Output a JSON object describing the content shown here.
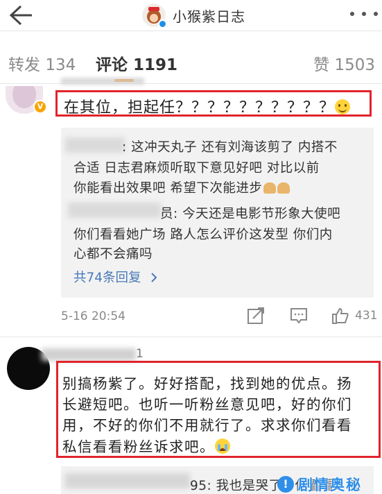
{
  "header": {
    "title": "小猴紫日志",
    "back_icon": "back-arrow-icon",
    "more_icon": "more-dots-icon"
  },
  "tabs": [
    {
      "label": "转发",
      "count": "134"
    },
    {
      "label": "评论",
      "count": "1191"
    },
    {
      "label": "赞",
      "count": "1503"
    }
  ],
  "comment1": {
    "text": "在其位，担起任？？？？？？？？？？",
    "emoji": "smile-emoji",
    "replies": [
      {
        "name_suffix": ":",
        "lines": [
          "这冲天丸子  还有刘海该剪了  内搭不",
          "合适  日志君麻烦听取下意见好吧  对比以前",
          "你能看出效果吧  希望下次能进步"
        ]
      },
      {
        "name_suffix": "员:",
        "lines": [
          "今天还是电影节形象大使吧",
          "你们看看她广场  路人怎么评价这发型  你们内",
          "心都不会痛吗"
        ]
      }
    ],
    "more_replies": "共74条回复 ",
    "time": "5-16 20:54",
    "likes": "431"
  },
  "comment2": {
    "name_tail": "1",
    "lines": [
      "别搞杨紫了。好好搭配，找到她的优点。扬",
      "长避短吧。也听一听粉丝意见吧，好的你们",
      "用，不好的你们不用就行了。求求你们看看",
      "私信看看粉丝诉求吧。"
    ],
    "reply": {
      "name_tail": "95:",
      "text": "我也是哭了！你看看！头"
    }
  },
  "watermark": {
    "text": "剧情奥秘"
  },
  "colors": {
    "accent": "#ff8200",
    "highlight_box": "#e0232b",
    "link": "#4a7ab8",
    "watermark": "#2f8fe8"
  }
}
